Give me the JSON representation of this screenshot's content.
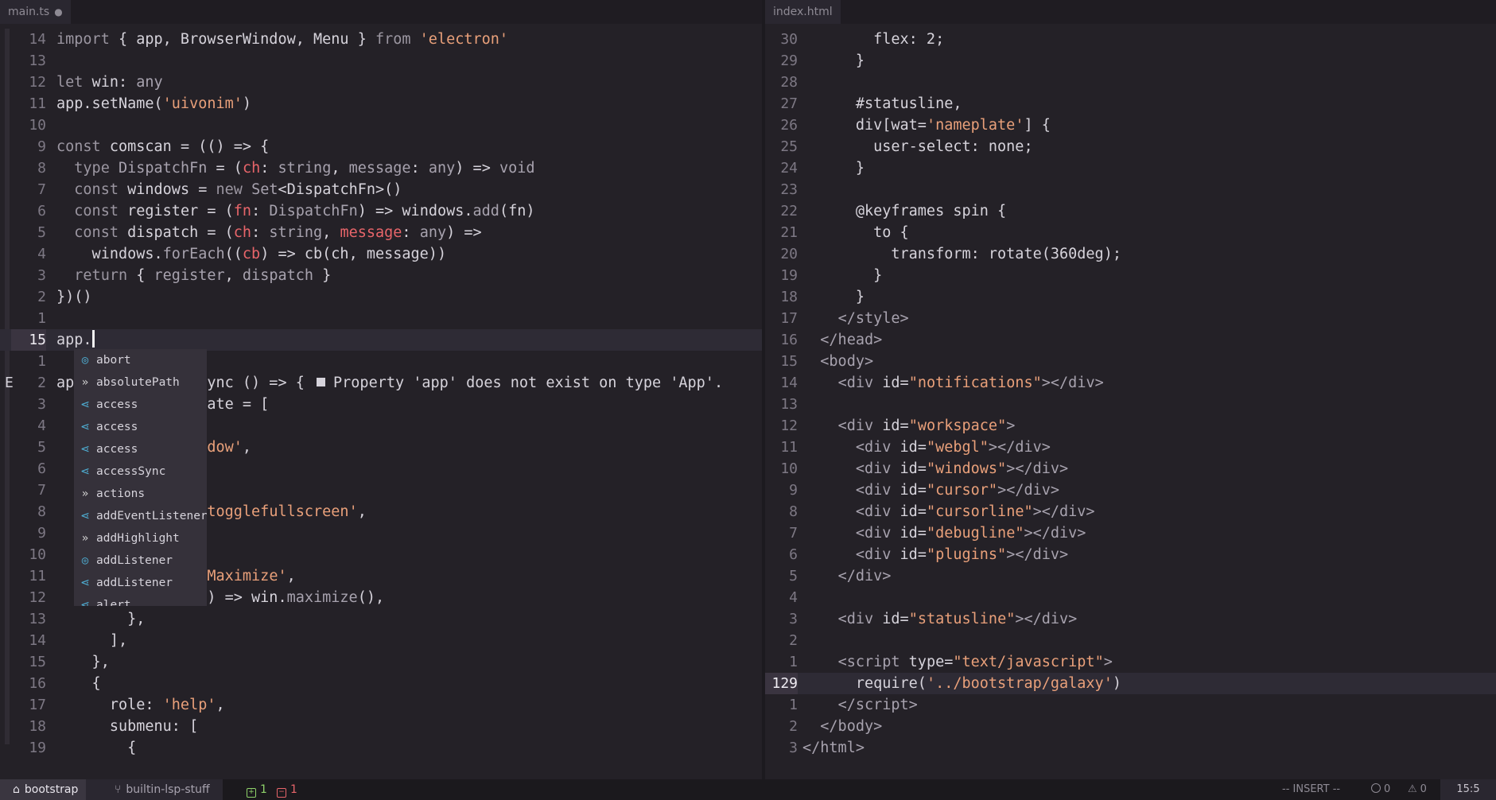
{
  "left_pane": {
    "tab_label": "main.ts",
    "modified_marker": "●",
    "lines": [
      {
        "n": "14",
        "html": "<span class='kw'>import</span> { app, BrowserWindow, Menu } <span class='kw'>from</span> <span class='str'>'electron'</span>"
      },
      {
        "n": "13",
        "html": ""
      },
      {
        "n": "12",
        "html": "<span class='kw'>let</span> win: <span class='ty'>any</span>"
      },
      {
        "n": "11",
        "html": "app.setName(<span class='str'>'uivonim'</span>)"
      },
      {
        "n": "10",
        "html": ""
      },
      {
        "n": "9",
        "html": "<span class='kw'>const</span> comscan = (() => {"
      },
      {
        "n": "8",
        "html": "  <span class='kw'>type</span> <span class='ty'>DispatchFn</span> = (<span class='pm'>ch</span>: <span class='ty'>string</span>, <span class='ty'>message</span>: <span class='ty'>any</span>) => <span class='ty'>void</span>"
      },
      {
        "n": "7",
        "html": "  <span class='kw'>const</span> windows = <span class='kw'>new</span> <span class='ty'>Set</span>&lt;DispatchFn&gt;()"
      },
      {
        "n": "6",
        "html": "  <span class='kw'>const</span> register = (<span class='pm'>fn</span>: <span class='ty'>DispatchFn</span>) => windows.<span class='ty'>add</span>(fn)"
      },
      {
        "n": "5",
        "html": "  <span class='kw'>const</span> dispatch = (<span class='pm'>ch</span>: <span class='ty'>string</span>, <span class='pm'>message</span>: <span class='ty'>any</span>) =>"
      },
      {
        "n": "4",
        "html": "    windows.<span class='ty'>forEach</span>((<span class='pm'>cb</span>) => cb(ch, message))"
      },
      {
        "n": "3",
        "html": "  <span class='kw'>return</span> { <span class='ty'>register</span>, <span class='ty'>dispatch</span> }"
      },
      {
        "n": "2",
        "html": "})()"
      },
      {
        "n": "1",
        "html": ""
      },
      {
        "n": "15",
        "html": "app.",
        "current": true
      },
      {
        "n": "1",
        "html": ""
      },
      {
        "n": "2",
        "html": "ap              sync () => { ",
        "diag": true
      },
      {
        "n": "3",
        "html": "                 ate = ["
      },
      {
        "n": "4",
        "html": ""
      },
      {
        "n": "5",
        "html": "                 <span class='str'>dow'</span>,"
      },
      {
        "n": "6",
        "html": ""
      },
      {
        "n": "7",
        "html": ""
      },
      {
        "n": "8",
        "html": "                 <span class='str'>togglefullscreen'</span>,"
      },
      {
        "n": "9",
        "html": ""
      },
      {
        "n": "10",
        "html": ""
      },
      {
        "n": "11",
        "html": "                <span class='str'>'Maximize'</span>,"
      },
      {
        "n": "12",
        "html": "                () => win.<span class='ty'>maximize</span>(),"
      },
      {
        "n": "13",
        "html": "        },"
      },
      {
        "n": "14",
        "html": "      ],"
      },
      {
        "n": "15",
        "html": "    },"
      },
      {
        "n": "16",
        "html": "    {"
      },
      {
        "n": "17",
        "html": "      role: <span class='str'>'help'</span>,"
      },
      {
        "n": "18",
        "html": "      submenu: ["
      },
      {
        "n": "19",
        "html": "        {"
      }
    ],
    "sign_column_letter": "E",
    "diagnostic_message": "Property 'app' does not exist on type 'App'."
  },
  "completion": {
    "items": [
      {
        "kind": "prop",
        "label": "abort"
      },
      {
        "kind": "kwd",
        "label": "absolutePath"
      },
      {
        "kind": "fnc",
        "label": "access"
      },
      {
        "kind": "fnc",
        "label": "access"
      },
      {
        "kind": "fnc",
        "label": "access"
      },
      {
        "kind": "fnc",
        "label": "accessSync"
      },
      {
        "kind": "kwd",
        "label": "actions"
      },
      {
        "kind": "fnc",
        "label": "addEventListener"
      },
      {
        "kind": "kwd",
        "label": "addHighlight"
      },
      {
        "kind": "prop",
        "label": "addListener"
      },
      {
        "kind": "fnc",
        "label": "addListener"
      },
      {
        "kind": "fnc",
        "label": "alert"
      }
    ]
  },
  "right_pane": {
    "tab_label": "index.html",
    "lines": [
      {
        "n": "30",
        "html": "        flex: 2;"
      },
      {
        "n": "29",
        "html": "      }"
      },
      {
        "n": "28",
        "html": ""
      },
      {
        "n": "27",
        "html": "      #statusline,"
      },
      {
        "n": "26",
        "html": "      div[wat=<span class='str'>'nameplate'</span>] {"
      },
      {
        "n": "25",
        "html": "        user-select: none;"
      },
      {
        "n": "24",
        "html": "      }"
      },
      {
        "n": "23",
        "html": ""
      },
      {
        "n": "22",
        "html": "      @keyframes spin {"
      },
      {
        "n": "21",
        "html": "        to {"
      },
      {
        "n": "20",
        "html": "          transform: rotate(360deg);"
      },
      {
        "n": "19",
        "html": "        }"
      },
      {
        "n": "18",
        "html": "      }"
      },
      {
        "n": "17",
        "html": "    <span class='tag'>&lt;/style&gt;</span>"
      },
      {
        "n": "16",
        "html": "  <span class='tag'>&lt;/head&gt;</span>"
      },
      {
        "n": "15",
        "html": "  <span class='tag'>&lt;body&gt;</span>"
      },
      {
        "n": "14",
        "html": "    <span class='tag'>&lt;div</span> id=<span class='str'>\"notifications\"</span><span class='tag'>&gt;&lt;/div&gt;</span>"
      },
      {
        "n": "13",
        "html": ""
      },
      {
        "n": "12",
        "html": "    <span class='tag'>&lt;div</span> id=<span class='str'>\"workspace\"</span><span class='tag'>&gt;</span>"
      },
      {
        "n": "11",
        "html": "      <span class='tag'>&lt;div</span> id=<span class='str'>\"webgl\"</span><span class='tag'>&gt;&lt;/div&gt;</span>"
      },
      {
        "n": "10",
        "html": "      <span class='tag'>&lt;div</span> id=<span class='str'>\"windows\"</span><span class='tag'>&gt;&lt;/div&gt;</span>"
      },
      {
        "n": "9",
        "html": "      <span class='tag'>&lt;div</span> id=<span class='str'>\"cursor\"</span><span class='tag'>&gt;&lt;/div&gt;</span>"
      },
      {
        "n": "8",
        "html": "      <span class='tag'>&lt;div</span> id=<span class='str'>\"cursorline\"</span><span class='tag'>&gt;&lt;/div&gt;</span>"
      },
      {
        "n": "7",
        "html": "      <span class='tag'>&lt;div</span> id=<span class='str'>\"debugline\"</span><span class='tag'>&gt;&lt;/div&gt;</span>"
      },
      {
        "n": "6",
        "html": "      <span class='tag'>&lt;div</span> id=<span class='str'>\"plugins\"</span><span class='tag'>&gt;&lt;/div&gt;</span>"
      },
      {
        "n": "5",
        "html": "    <span class='tag'>&lt;/div&gt;</span>"
      },
      {
        "n": "4",
        "html": ""
      },
      {
        "n": "3",
        "html": "    <span class='tag'>&lt;div</span> id=<span class='str'>\"statusline\"</span><span class='tag'>&gt;&lt;/div&gt;</span>"
      },
      {
        "n": "2",
        "html": ""
      },
      {
        "n": "1",
        "html": "    <span class='tag'>&lt;script</span> type=<span class='str'>\"text/javascript\"</span><span class='tag'>&gt;</span>"
      },
      {
        "n": "129",
        "html": "      require(<span class='str'>'../bootstrap/galaxy'</span>)",
        "current": true
      },
      {
        "n": "1",
        "html": "    <span class='tag'>&lt;/script&gt;</span>"
      },
      {
        "n": "2",
        "html": "  <span class='tag'>&lt;/body&gt;</span>"
      },
      {
        "n": "3",
        "html": "<span class='tag'>&lt;/html&gt;</span>"
      }
    ]
  },
  "statusbar": {
    "project": "bootstrap",
    "branch": "builtin-lsp-stuff",
    "added": "1",
    "removed": "1",
    "mode": "-- INSERT --",
    "errors": "0",
    "warnings": "0",
    "position": "15:5"
  }
}
